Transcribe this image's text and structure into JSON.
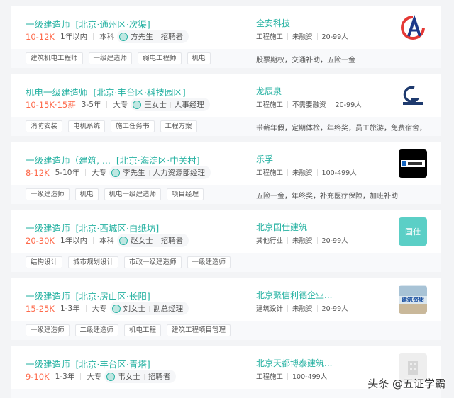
{
  "jobs": [
    {
      "title": "一级建造师",
      "location": "[北京·通州区·次渠]",
      "salary": "10-12K",
      "experience": "1年以内",
      "education": "本科",
      "recruiter_name": "方先生",
      "recruiter_role": "招聘者",
      "company": "全安科技",
      "industry": "工程施工",
      "funding": "未融资",
      "size": "20-99人",
      "tags": [
        "建筑机电工程师",
        "一级建造师",
        "弱电工程师",
        "机电"
      ],
      "welfare": "股票期权，交通补助，五险一金",
      "logo": {
        "type": "a-logo",
        "bg": "#ffffff"
      }
    },
    {
      "title": "机电一级建造师",
      "location": "[北京·丰台区·科技园区]",
      "salary": "10-15K·15薪",
      "experience": "3-5年",
      "education": "大专",
      "recruiter_name": "王女士",
      "recruiter_role": "人事经理",
      "company": "龙辰泉",
      "industry": "工程施工",
      "funding": "不需要融资",
      "size": "20-99人",
      "tags": [
        "消防安装",
        "电机系统",
        "施工任务书",
        "工程方案"
      ],
      "welfare": "带薪年假，定期体检，年终奖，员工旅游，免费宿舍，住...",
      "logo": {
        "type": "g-logo",
        "bg": "#ffffff"
      }
    },
    {
      "title": "一级建造师（建筑, ...",
      "location": "[北京·海淀区·中关村]",
      "salary": "8-12K",
      "experience": "5-10年",
      "education": "大专",
      "recruiter_name": "李先生",
      "recruiter_role": "人力资源部经理",
      "company": "乐孚",
      "industry": "工程施工",
      "funding": "未融资",
      "size": "100-499人",
      "tags": [
        "一级建造师",
        "机电",
        "机电一级建造师",
        "项目经理"
      ],
      "welfare": "五险一金，年终奖，补充医疗保险，加班补助",
      "logo": {
        "type": "black-logo",
        "bg": "#000000"
      }
    },
    {
      "title": "一级建造师",
      "location": "[北京·西城区·白纸坊]",
      "salary": "20-30K",
      "experience": "1年以内",
      "education": "本科",
      "recruiter_name": "赵女士",
      "recruiter_role": "招聘者",
      "company": "北京国仕建筑",
      "industry": "其他行业",
      "funding": "未融资",
      "size": "20-99人",
      "tags": [
        "结构设计",
        "城市规划设计",
        "市政一级建造师",
        "一级建造师"
      ],
      "welfare": "",
      "logo": {
        "type": "text-logo",
        "bg": "#5bcfc6",
        "text": "国仕"
      }
    },
    {
      "title": "一级建造师",
      "location": "[北京·房山区·长阳]",
      "salary": "15-25K",
      "experience": "1-3年",
      "education": "大专",
      "recruiter_name": "刘女士",
      "recruiter_role": "副总经理",
      "company": "北京聚信利德企业...",
      "industry": "建筑设计",
      "funding": "未融资",
      "size": "20-99人",
      "tags": [
        "一级建造师",
        "二级建造师",
        "机电工程",
        "建筑工程项目管理"
      ],
      "welfare": "",
      "logo": {
        "type": "photo-logo",
        "bg": "#dbe7ef",
        "text": "建筑资质"
      }
    },
    {
      "title": "一级建造师",
      "location": "[北京·丰台区·青塔]",
      "salary": "9-10K",
      "experience": "1-3年",
      "education": "大专",
      "recruiter_name": "韦女士",
      "recruiter_role": "招聘者",
      "company": "北京天都博泰建筑...",
      "industry": "工程施工",
      "funding": "",
      "size": "100-499人",
      "tags": [],
      "welfare": "",
      "logo": {
        "type": "gray-logo",
        "bg": "#eeeeee"
      }
    }
  ],
  "watermark": "头条 @五证学霸"
}
